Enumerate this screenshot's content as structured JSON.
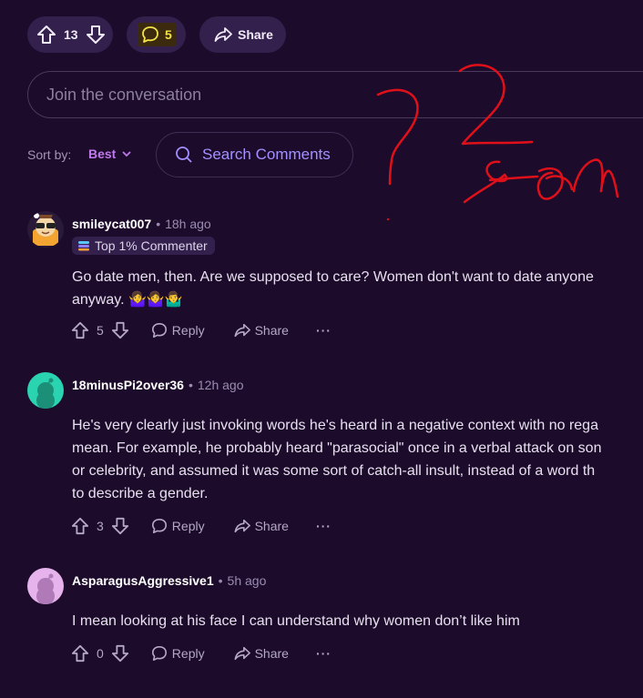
{
  "post_actions": {
    "upvote_count": "13",
    "comments_count": "5",
    "share_label": "Share"
  },
  "join": {
    "placeholder": "Join the conversation"
  },
  "sort": {
    "label": "Sort by:",
    "value": "Best"
  },
  "search": {
    "placeholder": "Search Comments"
  },
  "comments": [
    {
      "username": "smileycat007",
      "time": "18h ago",
      "badge": "Top 1% Commenter",
      "body_lines": [
        "Go date men, then. Are we supposed to care? Women don't want to date anyone",
        "anyway. 🤷‍♀️🤷‍♀️🤷‍♂️"
      ],
      "votes": "5",
      "reply_label": "Reply",
      "share_label": "Share",
      "more_label": "···"
    },
    {
      "username": "18minusPi2over36",
      "time": "12h ago",
      "body_lines": [
        "He's very clearly just invoking words he's heard in a negative context with no rega",
        "mean. For example, he probably heard \"parasocial\" once in a verbal attack on son",
        "or celebrity, and assumed it was some sort of catch-all insult, instead of a word th",
        "to describe a gender."
      ],
      "votes": "3",
      "reply_label": "Reply",
      "share_label": "Share",
      "more_label": "···"
    },
    {
      "username": "AsparagusAggressive1",
      "time": "5h ago",
      "body_lines": [
        "I mean looking at his face I can understand why women don’t like him"
      ],
      "votes": "0",
      "reply_label": "Reply",
      "share_label": "Share",
      "more_label": "···"
    }
  ],
  "colors": {
    "background": "#1c0b2b",
    "pill": "#33204d",
    "accent": "#c079ea",
    "scribble": "#e0101a"
  }
}
